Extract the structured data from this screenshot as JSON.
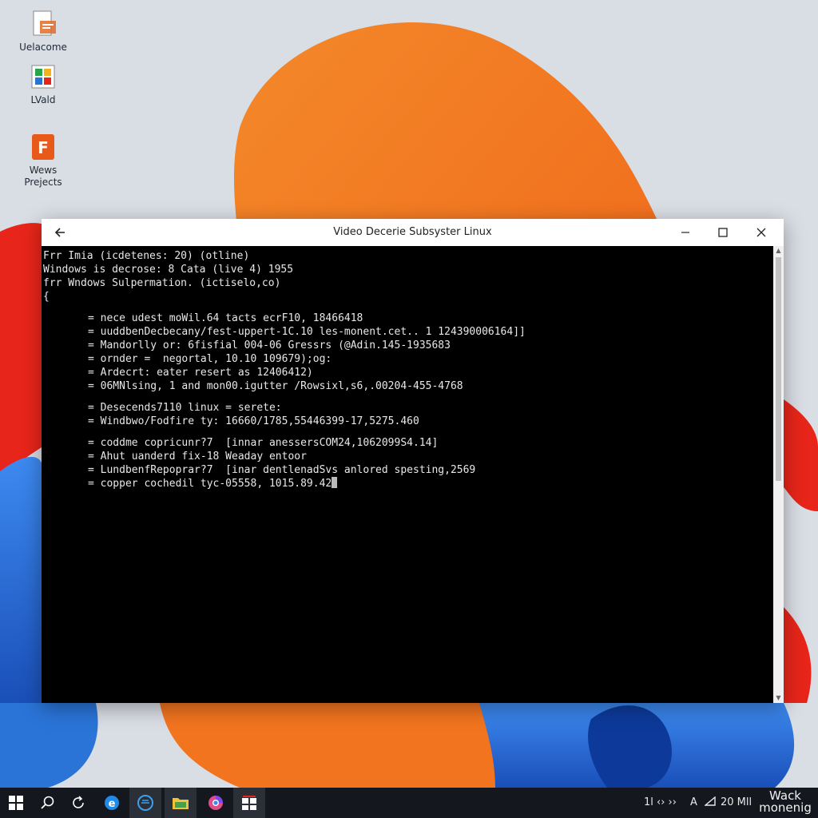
{
  "desktop": {
    "icons": [
      {
        "label": "Uelacome",
        "icon": "document-icon"
      },
      {
        "label": "LVald",
        "icon": "image-icon"
      },
      {
        "label": "Wews\nPrejects",
        "icon": "office-icon"
      }
    ]
  },
  "window": {
    "title": "Video Decerie Subsyster Linux",
    "terminal_lines": [
      {
        "text": "Frr Imia (icdetenes: 20) (otline)",
        "indent": false
      },
      {
        "text": "Windows is decrose: 8 Cata (live 4) 1955",
        "indent": false
      },
      {
        "text": "frr Wndows Sulpermation. (ictiselo,co)",
        "indent": false
      },
      {
        "text": "{",
        "indent": false
      },
      {
        "gap": true
      },
      {
        "text": "= nece udest moWil.64 tacts ecrF10, 18466418",
        "indent": true
      },
      {
        "text": "= uuddbenDecbecany/fest-uppert-1C.10 les-monent.cet.. 1 124390006164]]",
        "indent": true
      },
      {
        "text": "= Mandorlly or: 6fisfial 004-06 Gressrs (@Adin.145-1935683",
        "indent": true
      },
      {
        "text": "= ornder =  negortal, 10.10 109679);og:",
        "indent": true
      },
      {
        "text": "= Ardecrt: eater resert as 12406412)",
        "indent": true
      },
      {
        "text": "= 06MNlsing, 1 and mon00.igutter /Rowsixl,s6,.00204-455-4768",
        "indent": true
      },
      {
        "gap": true
      },
      {
        "text": "= Desecends7110 linux = serete:",
        "indent": true
      },
      {
        "text": "= Windbwo/Fodfire ty: 16660/1785,55446399-17,5275.460",
        "indent": true
      },
      {
        "gap": true
      },
      {
        "text": "= coddme copricunr?7  [innar anessersCOM24,1062099S4.14]",
        "indent": true
      },
      {
        "text": "= Ahut uanderd fix-18 Weaday entoor",
        "indent": true
      },
      {
        "text": "= LundbenfRepoprar?7  [inar dentlenadSvs anlored spesting,2569",
        "indent": true
      },
      {
        "text": "= copper cochedil tyc-05558, 1015.89.42",
        "indent": true,
        "cursor": true
      }
    ]
  },
  "taskbar": {
    "items": [
      "windows-start-icon",
      "search-icon",
      "refresh-icon",
      "edge-icon",
      "browser-icon",
      "file-explorer-icon",
      "chrome-icon",
      "store-icon"
    ],
    "tray": {
      "status": "1l ‹› ››",
      "font_indicator": "A",
      "volume": "20 Mll",
      "clock_line1": "Wack",
      "clock_line2": "monenig"
    }
  },
  "colors": {
    "orange": "#f26c1e",
    "red": "#e8251a",
    "blue": "#2a74d8",
    "terminal_bg": "#000000",
    "taskbar_bg": "#14171d"
  }
}
